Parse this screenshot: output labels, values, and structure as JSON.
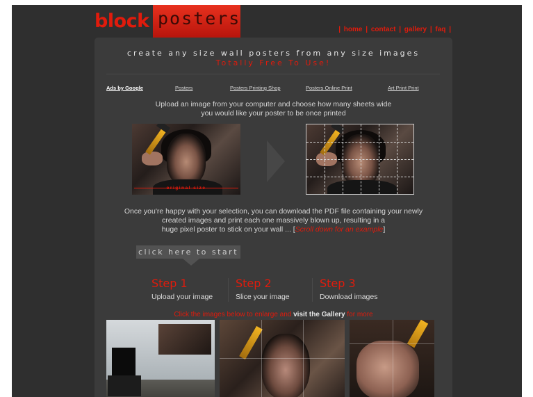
{
  "header": {
    "logo_left": "block",
    "logo_right": "posters",
    "nav": [
      "home",
      "contact",
      "gallery",
      "faq"
    ]
  },
  "tagline": {
    "line1": "create any size wall posters from any size images",
    "line2": "Totally Free To Use!"
  },
  "ads": {
    "label": "Ads by Google",
    "links": [
      "Posters",
      "Posters Printing Shop",
      "Posters Online Print",
      "Art Print Print"
    ]
  },
  "intro": {
    "line1": "Upload an image from your computer and choose how many sheets wide",
    "line2": "you would like your poster to be once printed"
  },
  "example": {
    "original_caption": "original size"
  },
  "description": {
    "line1": "Once you're happy with your selection, you can download the PDF file containing your newly",
    "line2": "created images and print each one massively blown up, resulting in a",
    "line3_before": "huge pixel poster to stick on your wall ... [",
    "line3_link": "Scroll down for an example",
    "line3_after": "]"
  },
  "start_button": "click here to start",
  "steps": [
    {
      "title": "Step 1",
      "desc": "Upload your image"
    },
    {
      "title": "Step 2",
      "desc": "Slice your image"
    },
    {
      "title": "Step 3",
      "desc": "Download images"
    }
  ],
  "gallery_line": {
    "before": "Click the images below to enlarge and ",
    "link": "visit the Gallery",
    "after": " for more"
  },
  "colors": {
    "accent": "#e01b0c",
    "background": "#2f2f2f",
    "panel": "#3b3b3b"
  }
}
